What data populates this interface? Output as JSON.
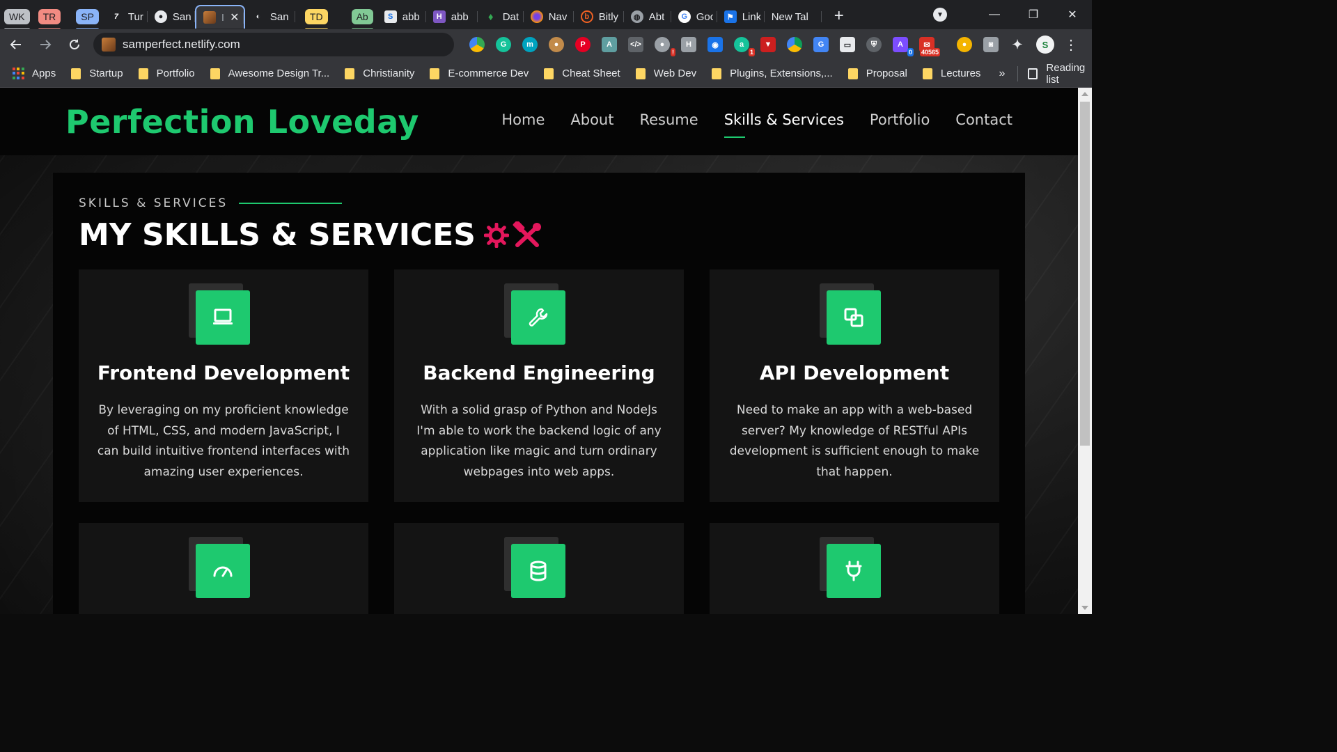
{
  "browser": {
    "tabs": [
      {
        "type": "group",
        "label": "WK",
        "color": "#bdc1c6"
      },
      {
        "type": "group",
        "label": "TR",
        "color": "#f28b82"
      },
      {
        "type": "group",
        "label": "SP",
        "color": "#8ab4f8"
      },
      {
        "type": "tab",
        "title": "Turi",
        "icon": "turing-icon"
      },
      {
        "type": "tab",
        "title": "San",
        "icon": "github-icon"
      },
      {
        "type": "tab",
        "title": "I",
        "icon": "site-portrait-icon",
        "active": true
      },
      {
        "type": "tab",
        "title": "San",
        "icon": "github-icon"
      },
      {
        "type": "group",
        "label": "TD",
        "color": "#fdd663"
      },
      {
        "type": "group",
        "label": "Ab",
        "color": "#81c995"
      },
      {
        "type": "tab",
        "title": "abb",
        "icon": "s-icon"
      },
      {
        "type": "tab",
        "title": "abb",
        "icon": "h-icon"
      },
      {
        "type": "tab",
        "title": "Dat",
        "icon": "mongodb-leaf-icon"
      },
      {
        "type": "tab",
        "title": "Nav",
        "icon": "firefox-icon"
      },
      {
        "type": "tab",
        "title": "Bitly",
        "icon": "bitly-icon"
      },
      {
        "type": "tab",
        "title": "Abt",
        "icon": "globe-icon"
      },
      {
        "type": "tab",
        "title": "Goc",
        "icon": "google-icon"
      },
      {
        "type": "tab",
        "title": "Link",
        "icon": "flag-icon"
      },
      {
        "type": "tab",
        "title": "New Tal",
        "icon": ""
      }
    ],
    "new_tab_symbol": "+",
    "window_controls": {
      "minimize": "—",
      "restore": "❐",
      "close": "✕"
    },
    "url": "samperfect.netlify.com",
    "extension_badges": {
      "notification_badge": "1",
      "mail_count": "40565",
      "zero_badge": "0"
    },
    "bookmarks": {
      "apps": "Apps",
      "items": [
        "Startup",
        "Portfolio",
        "Awesome Design Tr...",
        "Christianity",
        "E-commerce Dev",
        "Cheat Sheet",
        "Web Dev",
        "Plugins, Extensions,...",
        "Proposal",
        "Lectures"
      ],
      "more": "»",
      "reading_list": "Reading list"
    }
  },
  "site": {
    "logo": "Perfection Loveday",
    "nav": [
      "Home",
      "About",
      "Resume",
      "Skills & Services",
      "Portfolio",
      "Contact"
    ],
    "active_nav": "Skills & Services",
    "accent_color": "#1ec96f",
    "section": {
      "eyebrow": "SKILLS & SERVICES",
      "heading": "MY SKILLS & SERVICES",
      "heading_icons": [
        "gear-icon",
        "tools-icon"
      ],
      "cards": [
        {
          "icon": "laptop-icon",
          "title": "Frontend Development",
          "description": "By leveraging on my proficient knowledge of HTML, CSS, and modern JavaScript, I can build intuitive frontend interfaces with amazing user experiences."
        },
        {
          "icon": "wrench-icon",
          "title": "Backend Engineering",
          "description": "With a solid grasp of Python and NodeJs I'm able to work the backend logic of any application like magic and turn ordinary webpages into web apps."
        },
        {
          "icon": "clone-icon",
          "title": "API Development",
          "description": "Need to make an app with a web-based server? My knowledge of RESTful APIs development is sufficient enough to make that happen."
        },
        {
          "icon": "speedometer-icon",
          "title": "",
          "description": ""
        },
        {
          "icon": "database-icon",
          "title": "",
          "description": ""
        },
        {
          "icon": "plug-icon",
          "title": "",
          "description": ""
        }
      ]
    }
  }
}
